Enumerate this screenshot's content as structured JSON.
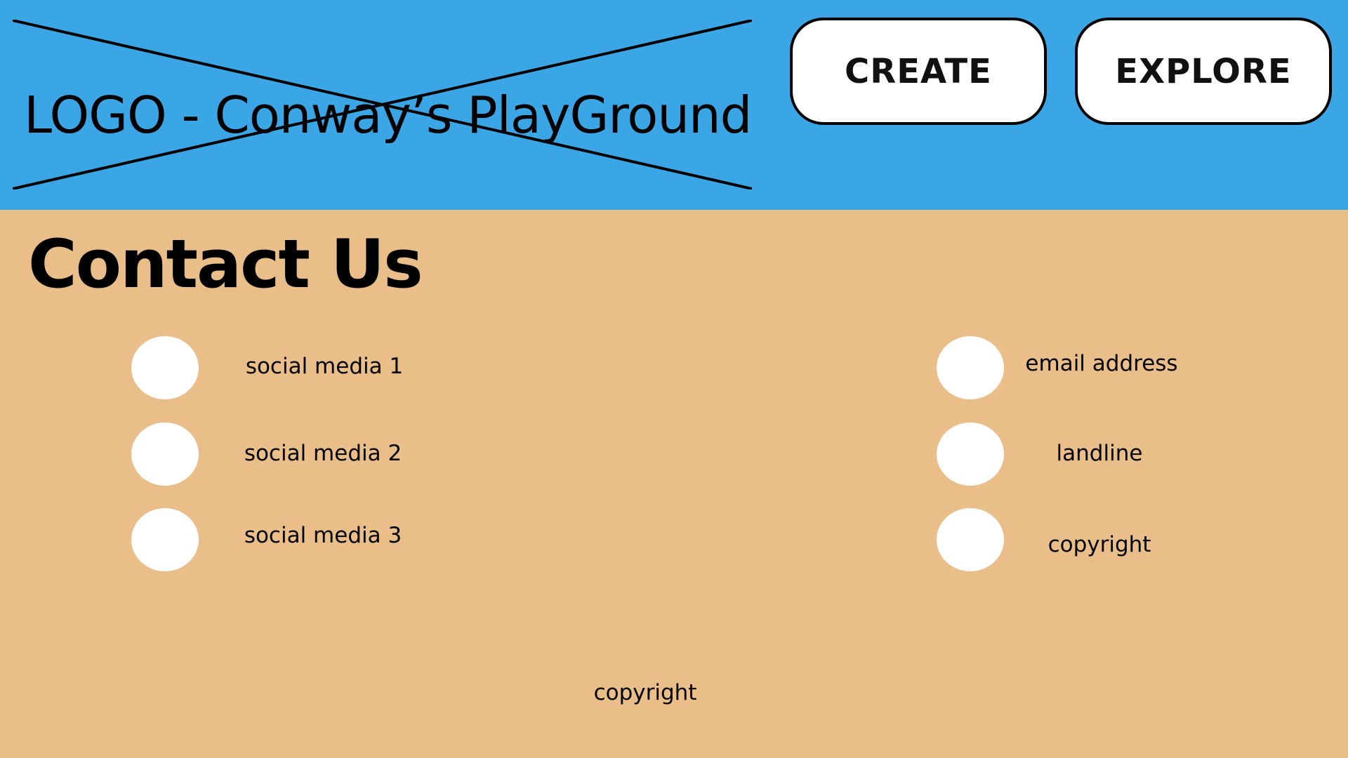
{
  "header": {
    "logo_text": "LOGO - Conway’s PlayGround",
    "nav": {
      "create_label": "CREATE",
      "explore_label": "EXPLORE"
    }
  },
  "main": {
    "title": "Contact Us",
    "social_links": [
      {
        "label": "social media 1",
        "icon": "circle-placeholder-icon"
      },
      {
        "label": "social media 2",
        "icon": "circle-placeholder-icon"
      },
      {
        "label": "social media 3",
        "icon": "circle-placeholder-icon"
      }
    ],
    "contact_details": [
      {
        "label": "email address",
        "icon": "circle-placeholder-icon"
      },
      {
        "label": "landline",
        "icon": "circle-placeholder-icon"
      },
      {
        "label": "copyright",
        "icon": "circle-placeholder-icon"
      }
    ]
  },
  "footer": {
    "text": "copyright"
  },
  "colors": {
    "header_bg": "#3BA6E5",
    "page_bg": "#EABE88",
    "button_bg": "#FFFFFF",
    "icon_fill": "#FFFFFF",
    "text": "#000000"
  }
}
